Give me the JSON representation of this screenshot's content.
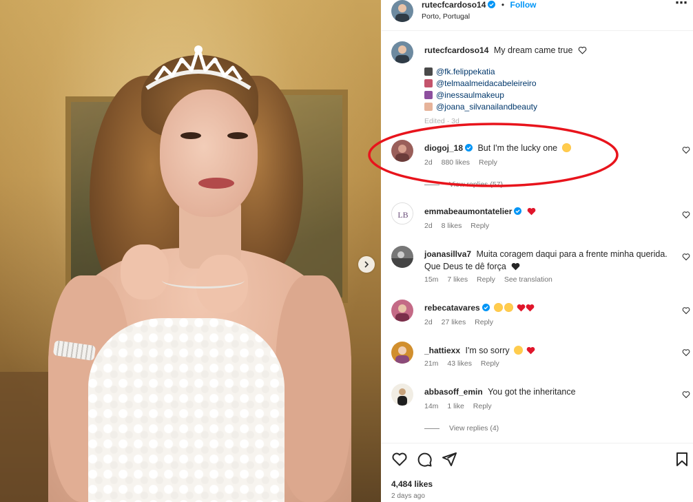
{
  "header": {
    "username": "rutecfcardoso14",
    "dot": "•",
    "follow_label": "Follow",
    "location": "Porto, Portugal",
    "more_label": "⋯"
  },
  "caption": {
    "username": "rutecfcardoso14",
    "text": "My dream came true",
    "tags": [
      "@fk.felippekatia",
      "@telmaalmeidacabeleireiro",
      "@inessaulmakeup",
      "@joana_silvanailandbeauty"
    ],
    "edited": "Edited · 3d"
  },
  "comments": [
    {
      "username": "diogoj_18",
      "verified": true,
      "text": "But I'm the lucky one",
      "emoji": "star-struck",
      "time": "2d",
      "likes": "880 likes",
      "reply": "Reply",
      "view_replies": "View replies (57)"
    },
    {
      "username": "emmabeaumontatelier",
      "verified": true,
      "text": "",
      "emoji": "red-heart",
      "time": "2d",
      "likes": "8 likes",
      "reply": "Reply"
    },
    {
      "username": "joanasillva7",
      "verified": false,
      "text": "Muita coragem daqui para a frente minha querida.",
      "text2": "Que Deus te dê força",
      "emoji": "black-heart",
      "time": "15m",
      "likes": "7 likes",
      "reply": "Reply",
      "translate": "See translation"
    },
    {
      "username": "rebecatavares",
      "verified": true,
      "text": "",
      "emoji": "star-struck star-struck red-heart red-heart",
      "time": "2d",
      "likes": "27 likes",
      "reply": "Reply"
    },
    {
      "username": "_hattiexx",
      "verified": false,
      "text": "I'm so sorry",
      "emoji": "sad red-heart",
      "time": "21m",
      "likes": "43 likes",
      "reply": "Reply"
    },
    {
      "username": "abbasoff_emin",
      "verified": false,
      "text": "You got the inheritance",
      "emoji": "",
      "time": "14m",
      "likes": "1 like",
      "reply": "Reply",
      "view_replies": "View replies (4)"
    }
  ],
  "footer": {
    "likes": "4,484 likes",
    "ago": "2 days ago"
  },
  "colors": {
    "accent": "#0095f6",
    "tag": "#00376b",
    "annotation": "#e8141c",
    "muted": "#737373"
  },
  "icons": [
    "heart-icon",
    "comment-icon",
    "share-icon",
    "bookmark-icon",
    "verified-icon",
    "more-icon",
    "next-arrow-icon"
  ]
}
